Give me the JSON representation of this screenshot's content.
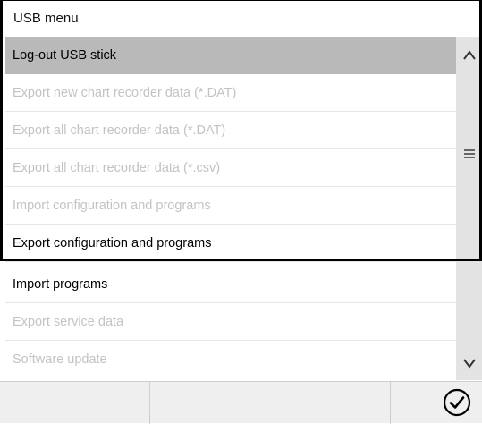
{
  "title": "USB menu",
  "menu": {
    "items": [
      {
        "label": "Log-out USB stick",
        "state": "selected"
      },
      {
        "label": "Export new chart recorder data (*.DAT)",
        "state": "disabled"
      },
      {
        "label": "Export all chart recorder data (*.DAT)",
        "state": "disabled"
      },
      {
        "label": "Export all chart recorder data (*.csv)",
        "state": "disabled"
      },
      {
        "label": "Import configuration and programs",
        "state": "disabled"
      },
      {
        "label": "Export configuration and programs",
        "state": "enabled"
      },
      {
        "label": "Import programs",
        "state": "enabled"
      },
      {
        "label": "Export service data",
        "state": "disabled"
      },
      {
        "label": "Software update",
        "state": "disabled"
      }
    ]
  },
  "scrollbar": {
    "up_icon": "chevron-up-icon",
    "thumb_icon": "menu-lines-icon",
    "down_icon": "chevron-down-icon"
  },
  "footer": {
    "confirm_icon": "check-circle-icon"
  },
  "colors": {
    "selected_bg": "#b9b9b9",
    "disabled_text": "#c3c3c3",
    "scrollbar_bg": "#e3e3e3",
    "footer_bg": "#efefef"
  }
}
